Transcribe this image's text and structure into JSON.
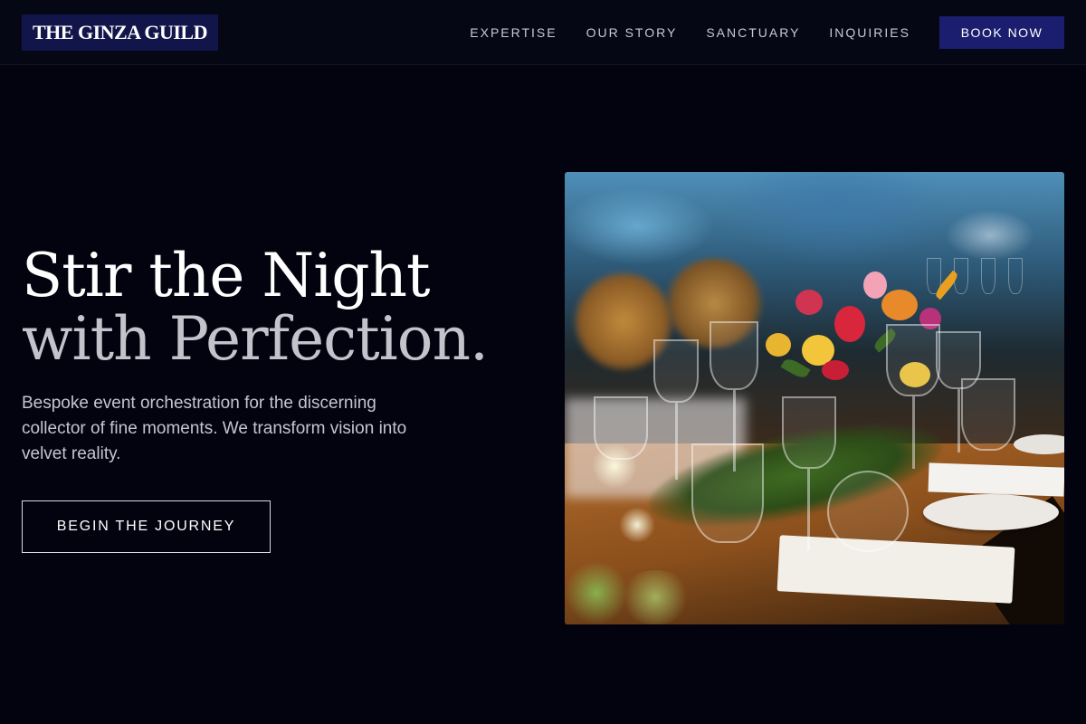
{
  "header": {
    "logo": "THE GINZA GUILD",
    "nav": [
      {
        "label": "EXPERTISE"
      },
      {
        "label": "OUR STORY"
      },
      {
        "label": "SANCTUARY"
      },
      {
        "label": "INQUIRIES"
      }
    ],
    "cta_label": "BOOK NOW"
  },
  "hero": {
    "headline_line1": "Stir the Night",
    "headline_line2": "with Perfection.",
    "subcopy": "Bespoke event orchestration for the discerning collector of fine moments. We transform vision into velvet reality.",
    "cta_label": "BEGIN THE JOURNEY"
  },
  "colors": {
    "background": "#03030f",
    "header_background": "#060715",
    "logo_background": "#12154a",
    "button_accent": "#1b1e6e"
  }
}
